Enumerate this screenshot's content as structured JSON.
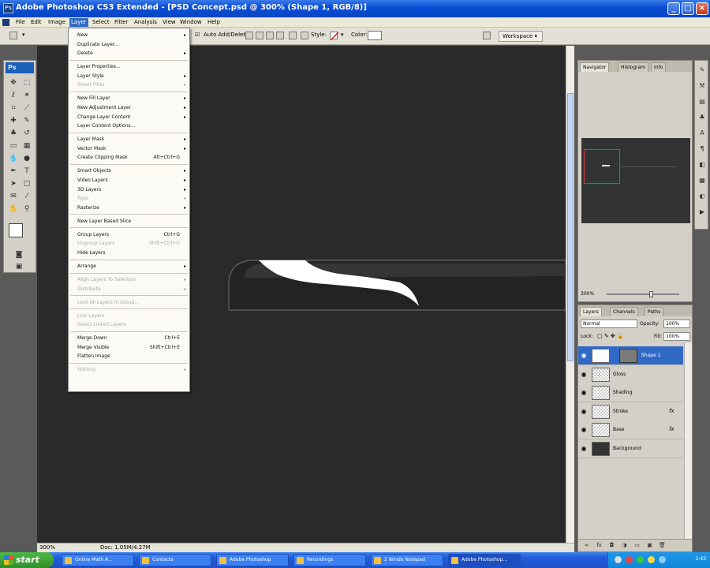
{
  "window": {
    "title": "Adobe Photoshop CS3 Extended - [PSD Concept.psd @ 300% (Shape 1, RGB/8)]",
    "app_icon_text": "Ps"
  },
  "menubar": {
    "items": [
      "File",
      "Edit",
      "Image",
      "Layer",
      "Select",
      "Filter",
      "Analysis",
      "View",
      "Window",
      "Help"
    ]
  },
  "options": {
    "auto_add_delete": "Auto Add/Delete",
    "style_label": "Style:",
    "color_label": "Color:",
    "workspace": "Workspace ▾"
  },
  "tools": {
    "logo": "Ps"
  },
  "layer_menu": {
    "items": [
      {
        "label": "New",
        "arrow": true
      },
      {
        "label": "Duplicate Layer..."
      },
      {
        "label": "Delete",
        "arrow": true
      },
      {
        "label": "Layer Properties..."
      },
      {
        "label": "Layer Style",
        "arrow": true
      },
      {
        "label": "Smart Filter",
        "arrow": true,
        "disabled": true
      },
      {
        "label": "New Fill Layer",
        "arrow": true
      },
      {
        "label": "New Adjustment Layer",
        "arrow": true
      },
      {
        "label": "Change Layer Content",
        "arrow": true
      },
      {
        "label": "Layer Content Options..."
      },
      {
        "label": "Layer Mask",
        "arrow": true
      },
      {
        "label": "Vector Mask",
        "arrow": true
      },
      {
        "label": "Create Clipping Mask",
        "shortcut": "Alt+Ctrl+G"
      },
      {
        "label": "Smart Objects",
        "arrow": true
      },
      {
        "label": "Video Layers",
        "arrow": true
      },
      {
        "label": "3D Layers",
        "arrow": true
      },
      {
        "label": "Type",
        "arrow": true,
        "disabled": true
      },
      {
        "label": "Rasterize",
        "arrow": true
      },
      {
        "label": "New Layer Based Slice"
      },
      {
        "label": "Group Layers",
        "shortcut": "Ctrl+G"
      },
      {
        "label": "Ungroup Layers",
        "shortcut": "Shift+Ctrl+G",
        "disabled": true
      },
      {
        "label": "Hide Layers"
      },
      {
        "label": "Arrange",
        "arrow": true
      },
      {
        "label": "Align Layers To Selection",
        "arrow": true,
        "disabled": true
      },
      {
        "label": "Distribute",
        "arrow": true,
        "disabled": true
      },
      {
        "label": "Lock All Layers in Group...",
        "disabled": true
      },
      {
        "label": "Link Layers",
        "disabled": true
      },
      {
        "label": "Select Linked Layers",
        "disabled": true
      },
      {
        "label": "Merge Down",
        "shortcut": "Ctrl+E"
      },
      {
        "label": "Merge Visible",
        "shortcut": "Shift+Ctrl+E"
      },
      {
        "label": "Flatten Image"
      },
      {
        "label": "Matting",
        "arrow": true,
        "disabled": true
      }
    ]
  },
  "navigator": {
    "tabs": [
      "Navigator",
      "Histogram",
      "Info"
    ],
    "zoom": "300%"
  },
  "layers_panel": {
    "tabs": [
      "Layers",
      "Channels",
      "Paths"
    ],
    "blend_mode": "Normal",
    "opacity_label": "Opacity:",
    "opacity": "100%",
    "lock_label": "Lock:",
    "fill_label": "Fill:",
    "fill": "100%",
    "layers": [
      {
        "name": "Shape 1",
        "selected": true,
        "thumb": "white",
        "mask": true,
        "fx": ""
      },
      {
        "name": "Gloss",
        "thumb": "checker",
        "fx": ""
      },
      {
        "name": "Shading",
        "thumb": "checker",
        "fx": ""
      },
      {
        "name": "Stroke",
        "thumb": "checker",
        "fx": "fx"
      },
      {
        "name": "Base",
        "thumb": "checker",
        "fx": "fx"
      },
      {
        "name": "Background",
        "thumb": "dark",
        "fx": ""
      }
    ]
  },
  "status": {
    "zoom": "300%",
    "doc": "Doc: 1.05M/4.27M"
  },
  "taskbar": {
    "start": "start",
    "tasks": [
      "Online Math A...",
      "Contacts",
      "Adobe Photoshop",
      "Recordings",
      "2 Windo Notepad",
      "Adobe Photoshop..."
    ],
    "active_task": 5,
    "clock": "2:43"
  },
  "colors": {
    "canvas_bg": "#2a2a2a",
    "shape_fill": "#232323",
    "shape_stroke": "#5a5a5a",
    "highlight": "#ffffff",
    "selection": "#3169c6"
  }
}
